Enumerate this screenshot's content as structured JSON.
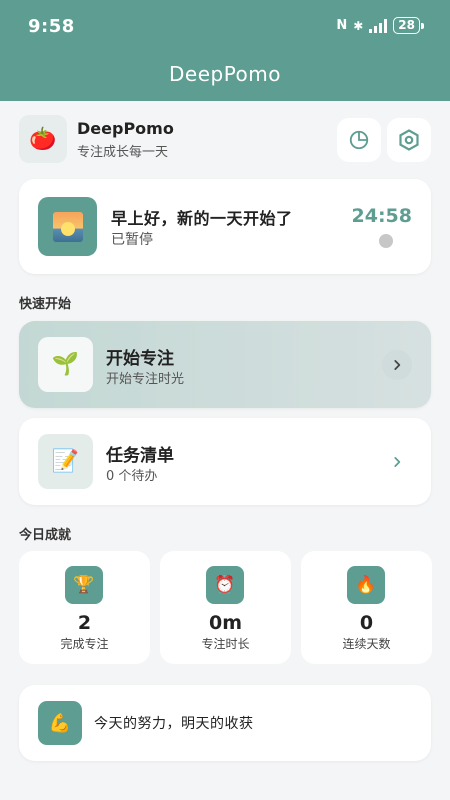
{
  "status_bar": {
    "time": "9:58",
    "nfc": "N",
    "bluetooth": "✱",
    "battery": "28"
  },
  "app_bar": {
    "title": "DeepPomo"
  },
  "profile": {
    "logo": "🍅",
    "name": "DeepPomo",
    "tagline": "专注成长每一天",
    "stats_icon": "pie-chart-icon",
    "settings_icon": "hexagon-settings-icon"
  },
  "greeting": {
    "text": "早上好，新的一天开始了",
    "status": "已暂停",
    "timer": "24:58"
  },
  "quick_start": {
    "label": "快速开始",
    "start": {
      "icon": "🌱",
      "title": "开始专注",
      "subtitle": "开始专注时光"
    },
    "tasks": {
      "icon": "📝",
      "title": "任务清单",
      "subtitle": "0 个待办"
    }
  },
  "today": {
    "label": "今日成就",
    "stats": [
      {
        "icon": "🏆",
        "value": "2",
        "label": "完成专注"
      },
      {
        "icon": "⏰",
        "value": "0m",
        "label": "专注时长"
      },
      {
        "icon": "🔥",
        "value": "0",
        "label": "连续天数"
      }
    ]
  },
  "motto": {
    "icon": "💪",
    "text": "今天的努力，明天的收获"
  },
  "colors": {
    "accent": "#5e9e92",
    "background": "#f4f5f6",
    "card": "#ffffff"
  }
}
